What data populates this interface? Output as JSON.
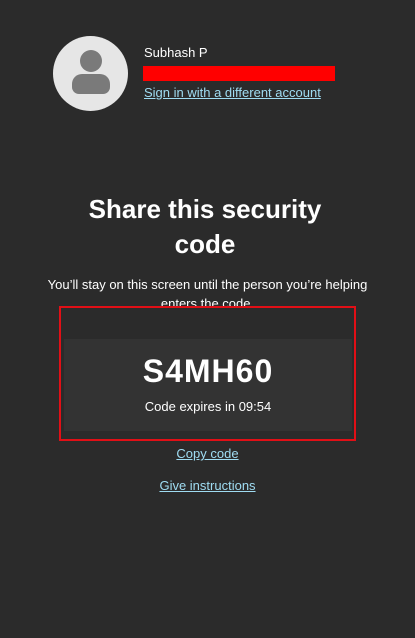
{
  "account": {
    "name": "Subhash P",
    "email_redacted": "",
    "switch_account_link": "Sign in with a different account",
    "avatar_icon": "person-icon"
  },
  "main": {
    "title": "Share this security code",
    "description": "You’ll stay on this screen until the person you’re helping enters the code.",
    "code": "S4MH60",
    "expiry_text": "Code expires in 09:54"
  },
  "links": {
    "copy_code": "Copy code",
    "give_instructions": "Give instructions"
  },
  "colors": {
    "background": "#2b2b2b",
    "panel": "#333333",
    "link": "#9fdcf2",
    "redaction": "#ff0000",
    "highlight_border": "#e10f16"
  }
}
